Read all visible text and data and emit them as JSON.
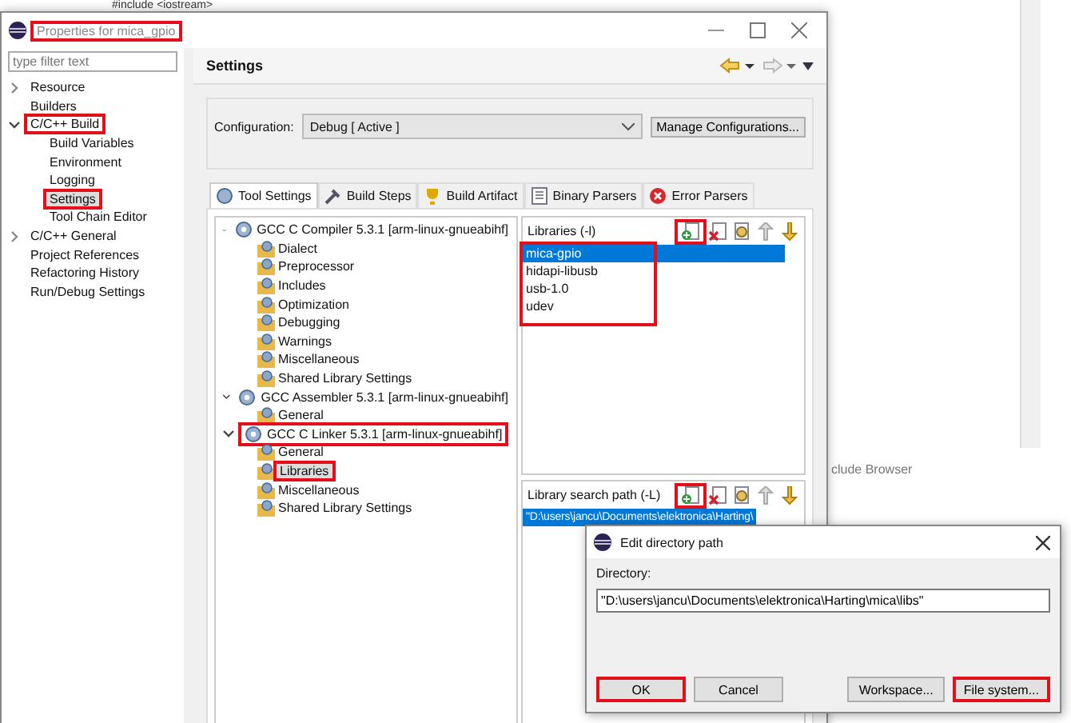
{
  "editor": {
    "code_line": "#include <iostream>",
    "tab_label": "clude Browser"
  },
  "window": {
    "title": "Properties for mica_gpio",
    "highlighted": true
  },
  "filter": {
    "placeholder": "type filter text"
  },
  "nav": [
    {
      "label": "Resource",
      "kind": "group",
      "expanded": false,
      "selected": false,
      "highlighted": false
    },
    {
      "label": "Builders",
      "kind": "page",
      "selected": false,
      "highlighted": false
    },
    {
      "label": "C/C++ Build",
      "kind": "group",
      "expanded": true,
      "selected": false,
      "highlighted": true,
      "children": [
        {
          "label": "Build Variables",
          "kind": "page",
          "selected": false,
          "highlighted": false
        },
        {
          "label": "Environment",
          "kind": "page",
          "selected": false,
          "highlighted": false
        },
        {
          "label": "Logging",
          "kind": "page",
          "selected": false,
          "highlighted": false
        },
        {
          "label": "Settings",
          "kind": "page",
          "selected": true,
          "highlighted": true
        },
        {
          "label": "Tool Chain Editor",
          "kind": "page",
          "selected": false,
          "highlighted": false
        }
      ]
    },
    {
      "label": "C/C++ General",
      "kind": "group",
      "expanded": false,
      "selected": false,
      "highlighted": false
    },
    {
      "label": "Project References",
      "kind": "page",
      "selected": false,
      "highlighted": false
    },
    {
      "label": "Refactoring History",
      "kind": "page",
      "selected": false,
      "highlighted": false
    },
    {
      "label": "Run/Debug Settings",
      "kind": "page",
      "selected": false,
      "highlighted": false
    }
  ],
  "page": {
    "title": "Settings",
    "configuration_label": "Configuration:",
    "configuration_value": "Debug  [ Active ]",
    "manage_button": "Manage Configurations..."
  },
  "tabs": [
    {
      "label": "Tool Settings",
      "selected": true
    },
    {
      "label": "Build Steps",
      "selected": false
    },
    {
      "label": "Build Artifact",
      "selected": false
    },
    {
      "label": "Binary Parsers",
      "selected": false
    },
    {
      "label": "Error Parsers",
      "selected": false
    }
  ],
  "tools": [
    {
      "label": "GCC C Compiler 5.3.1 [arm-linux-gnueabihf]",
      "expanded": true,
      "highlighted": false,
      "children": [
        {
          "label": "Dialect",
          "selected": false,
          "highlighted": false
        },
        {
          "label": "Preprocessor",
          "selected": false,
          "highlighted": false
        },
        {
          "label": "Includes",
          "selected": false,
          "highlighted": false
        },
        {
          "label": "Optimization",
          "selected": false,
          "highlighted": false
        },
        {
          "label": "Debugging",
          "selected": false,
          "highlighted": false
        },
        {
          "label": "Warnings",
          "selected": false,
          "highlighted": false
        },
        {
          "label": "Miscellaneous",
          "selected": false,
          "highlighted": false
        },
        {
          "label": "Shared Library Settings",
          "selected": false,
          "highlighted": false
        }
      ]
    },
    {
      "label": "GCC Assembler 5.3.1 [arm-linux-gnueabihf]",
      "expanded": true,
      "highlighted": false,
      "children": [
        {
          "label": "General",
          "selected": false,
          "highlighted": false
        }
      ]
    },
    {
      "label": "GCC C Linker 5.3.1 [arm-linux-gnueabihf]",
      "expanded": true,
      "highlighted": true,
      "children": [
        {
          "label": "General",
          "selected": false,
          "highlighted": false
        },
        {
          "label": "Libraries",
          "selected": true,
          "highlighted": true
        },
        {
          "label": "Miscellaneous",
          "selected": false,
          "highlighted": false
        },
        {
          "label": "Shared Library Settings",
          "selected": false,
          "highlighted": false
        }
      ]
    }
  ],
  "lists": [
    {
      "title": "Libraries (-l)",
      "add_highlighted": true,
      "items_highlighted": true,
      "items": [
        {
          "label": "mica-gpio",
          "selected": true
        },
        {
          "label": "hidapi-libusb",
          "selected": false
        },
        {
          "label": "usb-1.0",
          "selected": false
        },
        {
          "label": "udev",
          "selected": false
        }
      ]
    },
    {
      "title": "Library search path (-L)",
      "add_highlighted": true,
      "items_highlighted": false,
      "items": [
        {
          "label": "\"D:\\users\\jancu\\Documents\\elektronica\\Harting\\",
          "selected": true
        }
      ]
    }
  ],
  "dialog": {
    "title": "Edit directory path",
    "label": "Directory:",
    "value": "\"D:\\users\\jancu\\Documents\\elektronica\\Harting\\mica\\libs\"",
    "buttons": [
      {
        "label": "OK",
        "default": true,
        "highlighted": true
      },
      {
        "label": "Cancel",
        "default": false,
        "highlighted": false
      },
      {
        "label": "Workspace...",
        "default": false,
        "highlighted": false
      },
      {
        "label": "File system...",
        "default": false,
        "highlighted": true
      }
    ]
  }
}
